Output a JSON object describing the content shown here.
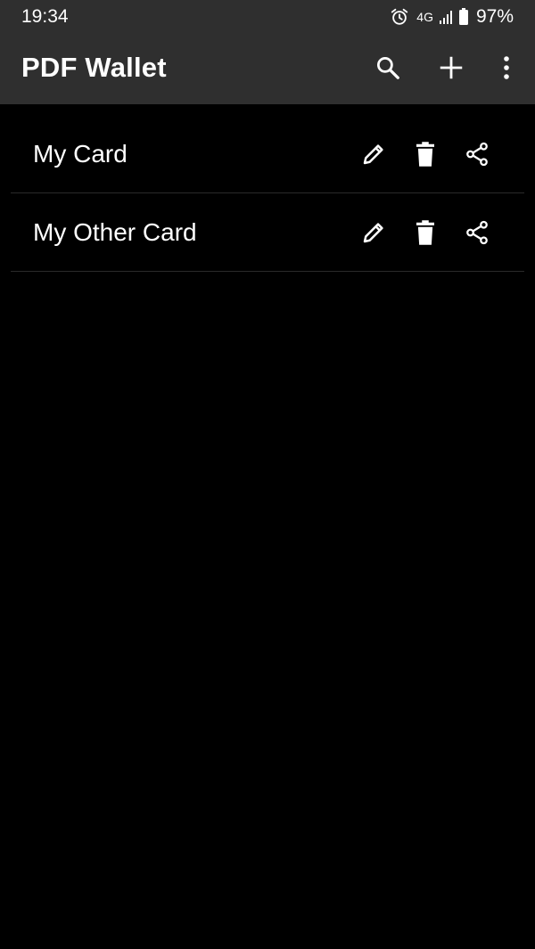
{
  "status_bar": {
    "time": "19:34",
    "network": "4G",
    "battery": "97%",
    "icons": [
      "alarm-icon",
      "signal-icon",
      "battery-icon"
    ]
  },
  "app_bar": {
    "title": "PDF Wallet",
    "actions": [
      "search-icon",
      "add-icon",
      "more-vert-icon"
    ]
  },
  "cards": [
    {
      "name": "My Card",
      "actions": [
        "edit-icon",
        "delete-icon",
        "share-icon"
      ]
    },
    {
      "name": "My Other Card",
      "actions": [
        "edit-icon",
        "delete-icon",
        "share-icon"
      ]
    }
  ],
  "colors": {
    "background": "#000000",
    "bar": "#2f2f2f",
    "text": "#ffffff",
    "divider": "#2a2a2a"
  }
}
